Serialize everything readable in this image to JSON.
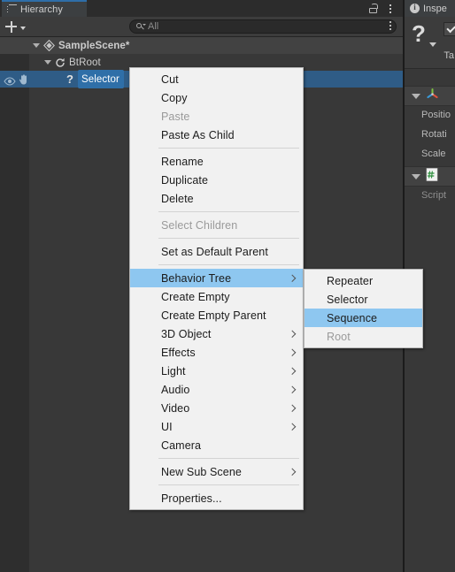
{
  "hierarchy": {
    "tab_label": "Hierarchy",
    "tab_icon": "list-icon",
    "lock_icon": "lock-icon",
    "kebab_icon": "kebab-menu-icon",
    "toolbar": {
      "create_label": "+",
      "create_icon": "plus-icon",
      "dropdown_icon": "chevron-down-icon",
      "search_icon": "search-icon",
      "search_placeholder": "All",
      "search_value": "",
      "kebab_icon": "kebab-menu-icon"
    },
    "rows": [
      {
        "name": "SampleScene*",
        "icon": "unity-scene-icon",
        "expanded": true
      },
      {
        "name": "BtRoot",
        "icon": "prefab-refresh-icon",
        "expanded": true
      },
      {
        "name": "Selector",
        "icon": "unknown-script-icon",
        "selected": true,
        "visibility_icon": "eye-icon",
        "pickability_icon": "hand-icon"
      }
    ]
  },
  "inspector": {
    "tab_label": "Inspe",
    "tab_icon": "info-icon",
    "object_icon": "question-mark-icon",
    "enabled_checked": true,
    "tag_label": "Ta",
    "components": [
      {
        "icon": "transform-axis-icon",
        "properties": [
          "Positio",
          "Rotati",
          "Scale"
        ]
      },
      {
        "icon": "csharp-script-icon",
        "properties": [
          "Script"
        ]
      }
    ]
  },
  "context_menu": {
    "items": [
      {
        "label": "Cut",
        "type": "item",
        "enabled": true,
        "highlighted": false,
        "submenu": false
      },
      {
        "label": "Copy",
        "type": "item",
        "enabled": true,
        "highlighted": false,
        "submenu": false
      },
      {
        "label": "Paste",
        "type": "item",
        "enabled": false,
        "highlighted": false,
        "submenu": false
      },
      {
        "label": "Paste As Child",
        "type": "item",
        "enabled": true,
        "highlighted": false,
        "submenu": false
      },
      {
        "label": "",
        "type": "separator"
      },
      {
        "label": "Rename",
        "type": "item",
        "enabled": true,
        "highlighted": false,
        "submenu": false
      },
      {
        "label": "Duplicate",
        "type": "item",
        "enabled": true,
        "highlighted": false,
        "submenu": false
      },
      {
        "label": "Delete",
        "type": "item",
        "enabled": true,
        "highlighted": false,
        "submenu": false
      },
      {
        "label": "",
        "type": "separator"
      },
      {
        "label": "Select Children",
        "type": "item",
        "enabled": false,
        "highlighted": false,
        "submenu": false
      },
      {
        "label": "",
        "type": "separator"
      },
      {
        "label": "Set as Default Parent",
        "type": "item",
        "enabled": true,
        "highlighted": false,
        "submenu": false
      },
      {
        "label": "",
        "type": "separator"
      },
      {
        "label": "Behavior Tree",
        "type": "item",
        "enabled": true,
        "highlighted": true,
        "submenu": true
      },
      {
        "label": "Create Empty",
        "type": "item",
        "enabled": true,
        "highlighted": false,
        "submenu": false
      },
      {
        "label": "Create Empty Parent",
        "type": "item",
        "enabled": true,
        "highlighted": false,
        "submenu": false
      },
      {
        "label": "3D Object",
        "type": "item",
        "enabled": true,
        "highlighted": false,
        "submenu": true
      },
      {
        "label": "Effects",
        "type": "item",
        "enabled": true,
        "highlighted": false,
        "submenu": true
      },
      {
        "label": "Light",
        "type": "item",
        "enabled": true,
        "highlighted": false,
        "submenu": true
      },
      {
        "label": "Audio",
        "type": "item",
        "enabled": true,
        "highlighted": false,
        "submenu": true
      },
      {
        "label": "Video",
        "type": "item",
        "enabled": true,
        "highlighted": false,
        "submenu": true
      },
      {
        "label": "UI",
        "type": "item",
        "enabled": true,
        "highlighted": false,
        "submenu": true
      },
      {
        "label": "Camera",
        "type": "item",
        "enabled": true,
        "highlighted": false,
        "submenu": false
      },
      {
        "label": "",
        "type": "separator"
      },
      {
        "label": "New Sub Scene",
        "type": "item",
        "enabled": true,
        "highlighted": false,
        "submenu": true
      },
      {
        "label": "",
        "type": "separator"
      },
      {
        "label": "Properties...",
        "type": "item",
        "enabled": true,
        "highlighted": false,
        "submenu": false
      }
    ]
  },
  "submenu": {
    "parent": "Behavior Tree",
    "items": [
      {
        "label": "Repeater",
        "type": "item",
        "enabled": true,
        "highlighted": false,
        "submenu": false
      },
      {
        "label": "Selector",
        "type": "item",
        "enabled": true,
        "highlighted": false,
        "submenu": false
      },
      {
        "label": "Sequence",
        "type": "item",
        "enabled": true,
        "highlighted": true,
        "submenu": false
      },
      {
        "label": "Root",
        "type": "item",
        "enabled": false,
        "highlighted": false,
        "submenu": false
      }
    ]
  },
  "colors": {
    "highlight_blue": "#8ec7f0",
    "selection_blue": "#2f5c86",
    "pill_blue": "#2f6fa8",
    "menu_bg": "#f1f1f1",
    "panel_bg": "#383838",
    "tab_accent": "#2e6ea8"
  }
}
